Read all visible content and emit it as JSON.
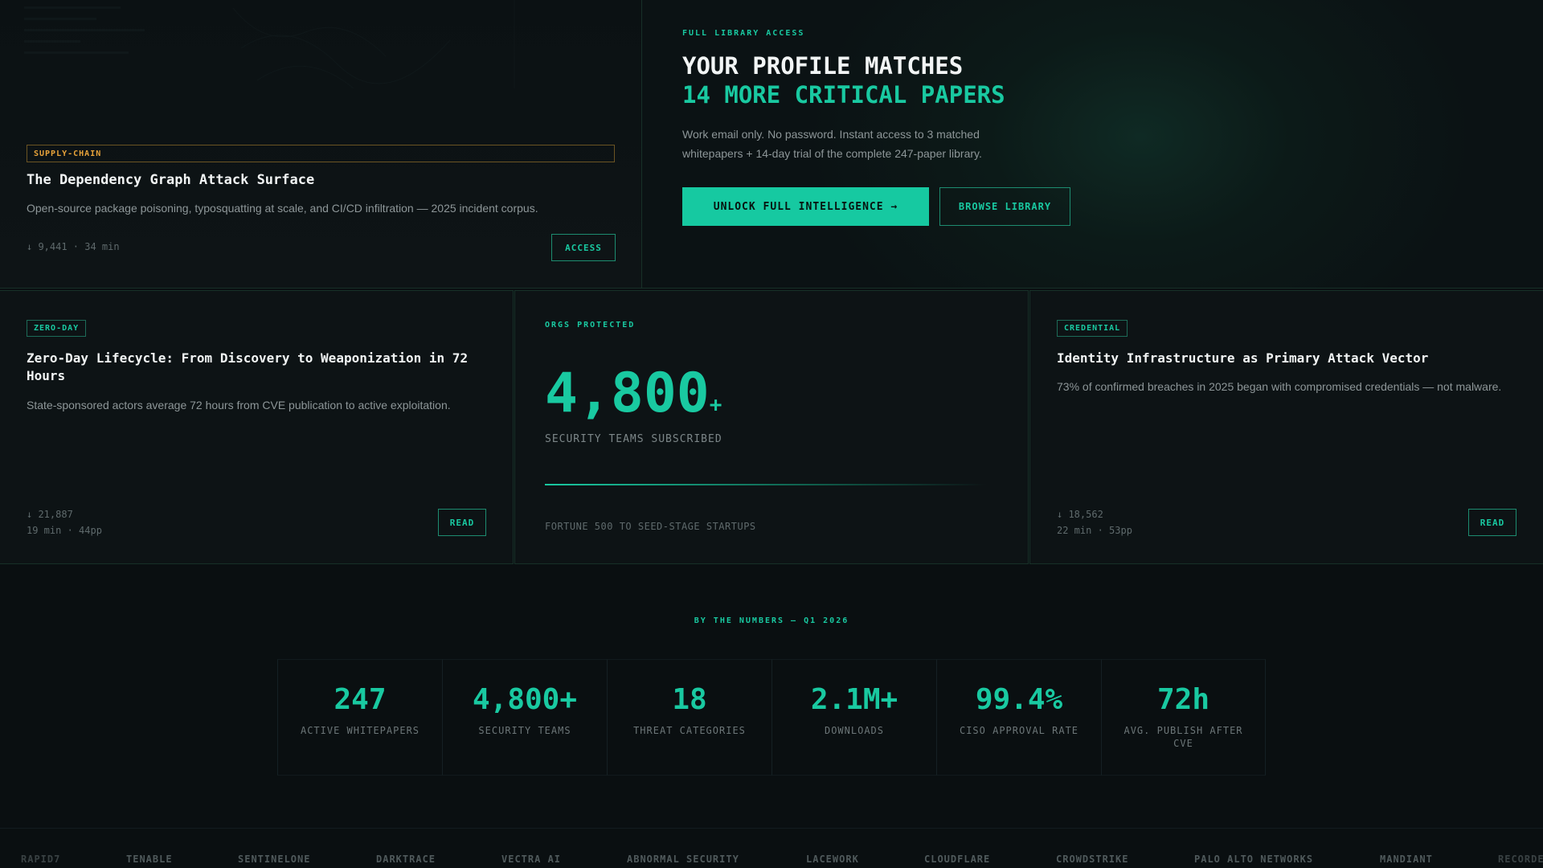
{
  "card_supply": {
    "badge": "SUPPLY-CHAIN",
    "title": "The Dependency Graph Attack Surface",
    "desc": "Open-source package poisoning, typosquatting at scale, and CI/CD infiltration — 2025 incident corpus.",
    "meta": "↓ 9,441 · 34 min",
    "action": "ACCESS"
  },
  "hero": {
    "eyebrow": "FULL LIBRARY ACCESS",
    "title_line1": "YOUR PROFILE MATCHES",
    "title_line2": "14 MORE CRITICAL PAPERS",
    "desc_line1": "Work email only. No password. Instant access to 3 matched",
    "desc_line2": "whitepapers + 14-day trial of the complete 247-paper library.",
    "primary_cta": "UNLOCK FULL INTELLIGENCE →",
    "secondary_cta": "BROWSE LIBRARY"
  },
  "card_zeroday": {
    "badge": "ZERO-DAY",
    "title": "Zero-Day Lifecycle: From Discovery to Weaponization in 72 Hours",
    "desc": "State-sponsored actors average 72 hours from CVE publication to active exploitation.",
    "meta_line1": "↓ 21,887",
    "meta_line2": "19 min · 44pp",
    "action": "READ"
  },
  "card_orgs": {
    "eyebrow": "ORGS PROTECTED",
    "value": "4,800",
    "suffix": "+",
    "label": "SECURITY TEAMS SUBSCRIBED",
    "footer": "FORTUNE 500 TO SEED-STAGE STARTUPS"
  },
  "card_credential": {
    "badge": "CREDENTIAL",
    "title": "Identity Infrastructure as Primary Attack Vector",
    "desc": "73% of confirmed breaches in 2025 began with compromised credentials — not malware.",
    "meta_line1": "↓ 18,562",
    "meta_line2": "22 min · 53pp",
    "action": "READ"
  },
  "numbers": {
    "eyebrow": "BY THE NUMBERS — Q1 2026",
    "stats": [
      {
        "value": "247",
        "label": "ACTIVE WHITEPAPERS"
      },
      {
        "value": "4,800+",
        "label": "SECURITY TEAMS"
      },
      {
        "value": "18",
        "label": "THREAT CATEGORIES"
      },
      {
        "value": "2.1M+",
        "label": "DOWNLOADS"
      },
      {
        "value": "99.4%",
        "label": "CISO APPROVAL RATE"
      },
      {
        "value": "72h",
        "label": "AVG. PUBLISH AFTER CVE"
      }
    ]
  },
  "partners": [
    "RAPID7",
    "TENABLE",
    "SENTINELONE",
    "DARKTRACE",
    "VECTRA AI",
    "ABNORMAL SECURITY",
    "LACEWORK",
    "CLOUDFLARE",
    "CROWDSTRIKE",
    "PALO ALTO NETWORKS",
    "MANDIANT",
    "RECORDED"
  ],
  "colors": {
    "accent": "#19c9a1",
    "amber": "#e8a33a",
    "background": "#0a0f11"
  }
}
